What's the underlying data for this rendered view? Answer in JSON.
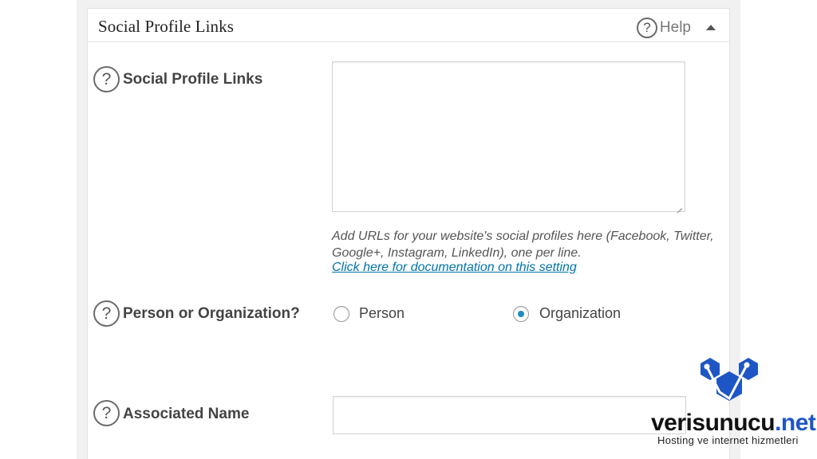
{
  "panel": {
    "title": "Social Profile Links",
    "help_icon": "question-circle-icon",
    "help_label": "Help",
    "toggle_icon": "triangle-up-icon"
  },
  "fields": {
    "social_links": {
      "label": "Social Profile Links",
      "value": "",
      "description": "Add URLs for your website's social profiles here (Facebook, Twitter, Google+, Instagram, LinkedIn), one per line.",
      "doc_link": "Click here for documentation on this setting"
    },
    "person_or_org": {
      "label": "Person or Organization?",
      "options": [
        {
          "label": "Person",
          "checked": false
        },
        {
          "label": "Organization",
          "checked": true
        }
      ]
    },
    "associated_name": {
      "label": "Associated Name",
      "value": ""
    }
  },
  "watermark": {
    "brand_main": "verisunucu",
    "brand_tld": ".net",
    "tagline": "Hosting ve internet hizmetleri"
  },
  "colors": {
    "link": "#0073aa",
    "radio_dot": "#1e8cbe",
    "brand_blue": "#1f56c5"
  }
}
